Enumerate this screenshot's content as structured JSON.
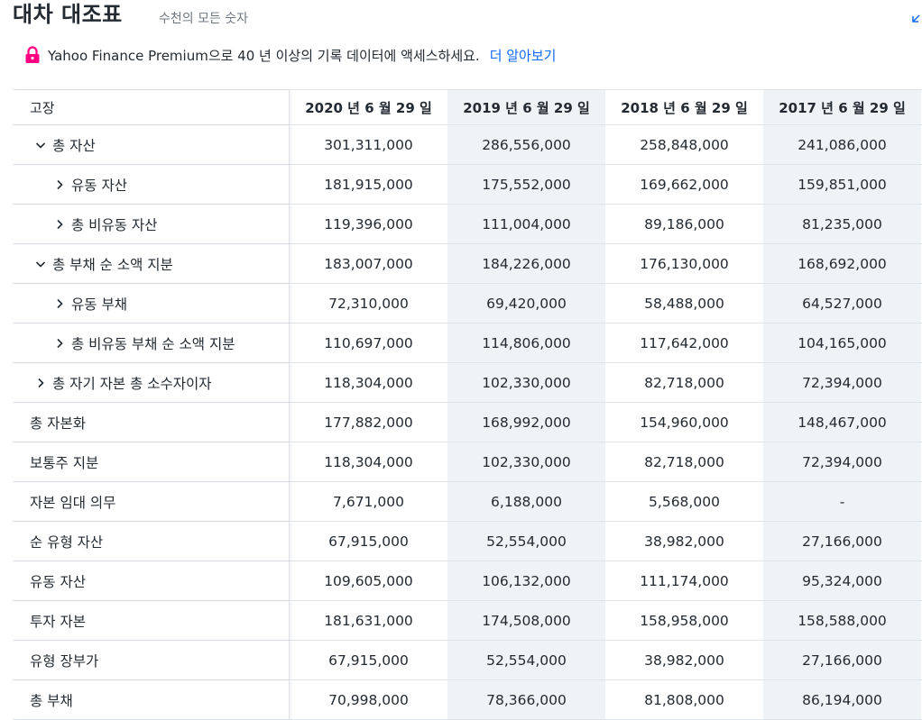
{
  "header": {
    "title": "대차 대조표",
    "subtitle": "수천의 모든 숫자"
  },
  "premium": {
    "icon": "lock-icon",
    "message": "Yahoo Finance Premium으로 40 년 이상의 기록 데이터에 액세스하세요.",
    "link_label": "더 알아보기",
    "accent_color": "#ff0080",
    "link_color": "#0f69ff"
  },
  "table": {
    "columns": [
      "고장",
      "2020 년 6 월 29 일",
      "2019 년 6 월 29 일",
      "2018 년 6 월 29 일",
      "2017 년 6 월 29 일"
    ],
    "rows": [
      {
        "label": "총 자산",
        "icon": "chevron-down-icon",
        "values": [
          "301,311,000",
          "286,556,000",
          "258,848,000",
          "241,086,000"
        ]
      },
      {
        "label": "유동 자산",
        "icon": "chevron-right-icon",
        "values": [
          "181,915,000",
          "175,552,000",
          "169,662,000",
          "159,851,000"
        ]
      },
      {
        "label": "총 비유동 자산",
        "icon": "chevron-right-icon",
        "values": [
          "119,396,000",
          "111,004,000",
          "89,186,000",
          "81,235,000"
        ]
      },
      {
        "label": "총 부채 순 소액 지분",
        "icon": "chevron-down-icon",
        "values": [
          "183,007,000",
          "184,226,000",
          "176,130,000",
          "168,692,000"
        ]
      },
      {
        "label": "유동 부채",
        "icon": "chevron-right-icon",
        "values": [
          "72,310,000",
          "69,420,000",
          "58,488,000",
          "64,527,000"
        ]
      },
      {
        "label": "총 비유동 부채 순 소액 지분",
        "icon": "chevron-right-icon",
        "values": [
          "110,697,000",
          "114,806,000",
          "117,642,000",
          "104,165,000"
        ]
      },
      {
        "label": "총 자기 자본 총 소수자이자",
        "icon": "chevron-right-icon",
        "values": [
          "118,304,000",
          "102,330,000",
          "82,718,000",
          "72,394,000"
        ]
      },
      {
        "label": "총 자본화",
        "values": [
          "177,882,000",
          "168,992,000",
          "154,960,000",
          "148,467,000"
        ]
      },
      {
        "label": "보통주 지분",
        "values": [
          "118,304,000",
          "102,330,000",
          "82,718,000",
          "72,394,000"
        ]
      },
      {
        "label": "자본 임대 의무",
        "values": [
          "7,671,000",
          "6,188,000",
          "5,568,000",
          "-"
        ]
      },
      {
        "label": "순 유형 자산",
        "values": [
          "67,915,000",
          "52,554,000",
          "38,982,000",
          "27,166,000"
        ]
      },
      {
        "label": "유동 자산",
        "values": [
          "109,605,000",
          "106,132,000",
          "111,174,000",
          "95,324,000"
        ]
      },
      {
        "label": "투자 자본",
        "values": [
          "181,631,000",
          "174,508,000",
          "158,958,000",
          "158,588,000"
        ]
      },
      {
        "label": "유형 장부가",
        "values": [
          "67,915,000",
          "52,554,000",
          "38,982,000",
          "27,166,000"
        ]
      },
      {
        "label": "총 부채",
        "values": [
          "70,998,000",
          "78,366,000",
          "81,808,000",
          "86,194,000"
        ]
      }
    ]
  }
}
